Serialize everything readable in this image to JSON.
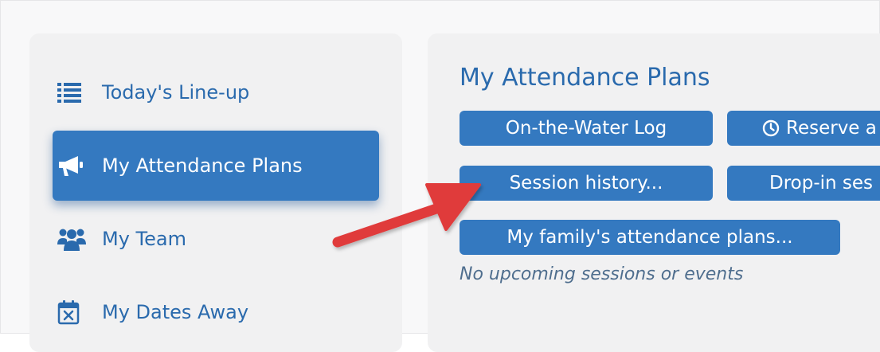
{
  "sidebar": {
    "items": [
      {
        "label": "Today's Line-up",
        "icon": "list-icon",
        "active": false
      },
      {
        "label": "My Attendance Plans",
        "icon": "megaphone-icon",
        "active": true
      },
      {
        "label": "My Team",
        "icon": "users-icon",
        "active": false
      },
      {
        "label": "My Dates Away",
        "icon": "calendar-x-icon",
        "active": false
      }
    ]
  },
  "main": {
    "title": "My Attendance Plans",
    "buttons": {
      "on_water_log": "On-the-Water Log",
      "reserve": "Reserve a",
      "session_history": "Session history...",
      "drop_in": "Drop-in ses",
      "family_plans": "My family's attendance plans..."
    },
    "empty_note": "No upcoming sessions or events"
  },
  "colors": {
    "accent": "#3479c0",
    "text_link": "#2a6aad",
    "annotation_arrow": "#e03b3b"
  }
}
